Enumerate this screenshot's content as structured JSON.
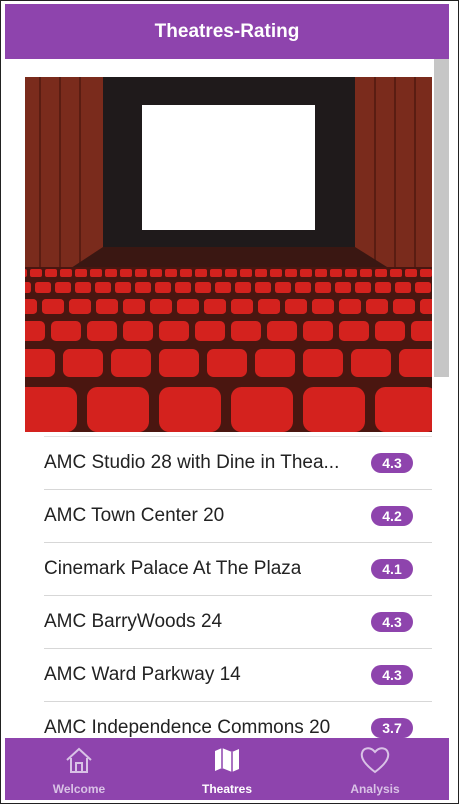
{
  "header": {
    "title": "Theatres-Rating"
  },
  "hero": {
    "image": "movie-theatre-photo"
  },
  "theatres": [
    {
      "name": "AMC Studio 28 with Dine in Thea...",
      "rating": "4.3"
    },
    {
      "name": "AMC Town Center 20",
      "rating": "4.2"
    },
    {
      "name": "Cinemark Palace At The Plaza",
      "rating": "4.1"
    },
    {
      "name": "AMC BarryWoods 24",
      "rating": "4.3"
    },
    {
      "name": "AMC Ward Parkway 14",
      "rating": "4.3"
    },
    {
      "name": "AMC Independence Commons 20",
      "rating": "3.7"
    }
  ],
  "tabs": [
    {
      "label": "Welcome",
      "icon": "home-icon",
      "active": false
    },
    {
      "label": "Theatres",
      "icon": "map-icon",
      "active": true
    },
    {
      "label": "Analysis",
      "icon": "heart-icon",
      "active": false
    }
  ],
  "colors": {
    "primary": "#8e44ad",
    "seat": "#d4221e"
  }
}
